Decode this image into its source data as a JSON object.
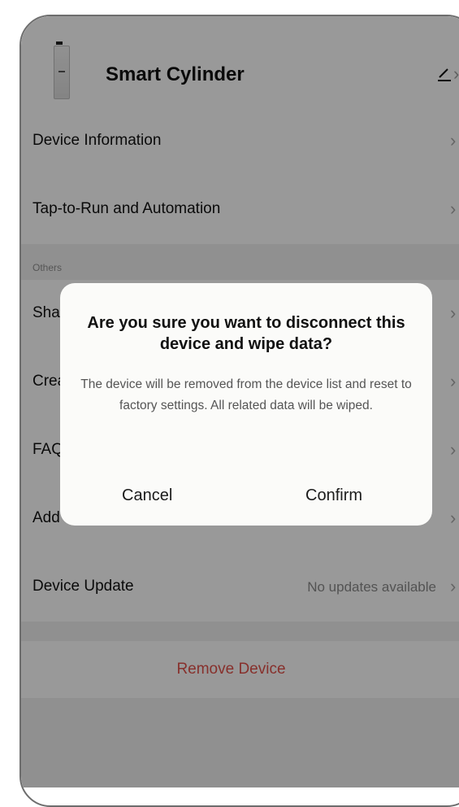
{
  "header": {
    "device_name": "Smart Cylinder"
  },
  "rows": {
    "device_information": "Device Information",
    "tap_to_run": "Tap-to-Run and Automation",
    "section_others": "Others",
    "share": "Share Device",
    "create_group": "Create Group",
    "faq": "FAQ & Feedback",
    "add_home_screen": "Add to Home Screen",
    "device_update": "Device Update",
    "device_update_value": "No updates available",
    "remove_device": "Remove Device"
  },
  "dialog": {
    "title": "Are you sure you want to disconnect this device and wipe data?",
    "message": "The device will be removed from the device list and reset to factory settings. All related data will be wiped.",
    "cancel_label": "Cancel",
    "confirm_label": "Confirm"
  },
  "colors": {
    "danger": "#e2514a",
    "overlay": "rgba(0,0,0,0.40)"
  },
  "icons": {
    "edit": "edit-icon",
    "chevron": "chevron-right-icon"
  }
}
